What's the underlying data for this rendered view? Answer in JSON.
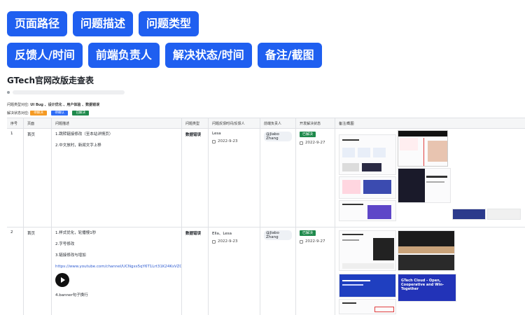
{
  "tags": {
    "row1": [
      "页面路径",
      "问题描述",
      "问题类型"
    ],
    "row2": [
      "反馈人/时间",
      "前端负责人",
      "解决状态/时间",
      "备注/截图"
    ]
  },
  "doc": {
    "title": "GTech官网改版走查表",
    "legend_type_label": "问题类型对应:",
    "legend_type_values": "UI Bug 、设计优化 、用户体验 、数据错误",
    "legend_status_label": "解决状态对应:",
    "status_pills": [
      {
        "label": "待解决",
        "color": "#f59a23"
      },
      {
        "label": "待确认",
        "color": "#2f6df6"
      },
      {
        "label": "已解决",
        "color": "#1f8a4c"
      }
    ]
  },
  "table": {
    "headers": [
      "序号",
      "页面",
      "问题描述",
      "问题类型",
      "问题反馈时间/反馈人",
      "前端负责人",
      "开发解决状态",
      "备注/截图"
    ],
    "rows": [
      {
        "index": "1",
        "page": "首页",
        "desc": [
          "1.跳转链接修改（至本站详情页）",
          "2.中文放时，新闻文字上移"
        ],
        "type": "数据错误",
        "reporter": "Lesa",
        "report_date": "2022-9-23",
        "owner": "@Jiabo Zhang",
        "status": "已解决",
        "status_date": "2022-9-27"
      },
      {
        "index": "2",
        "page": "首页",
        "desc": [
          "1.样式优化，轮播慢1秒",
          "2.字号修改",
          "3.链接修改与增加"
        ],
        "link": "https://www.youtube.com/channel/UCNgxs5qY6T1Lrt31K24KsVZQ",
        "desc_after": "4.banner句子换行",
        "type": "数据错误",
        "reporter": "Ella、Lesa",
        "report_date": "2022-9-23",
        "owner": "@Jiabo Zhang",
        "status": "已解决",
        "status_date": "2022-9-27"
      }
    ]
  },
  "screenshots": {
    "row2_card_title": "GTech Cloud - Open, Cooperative and Win-Together"
  },
  "colors": {
    "tag_blue": "#1f5ff0",
    "resolved_green": "#1f8a4c",
    "link_blue": "#2d5bd0"
  }
}
